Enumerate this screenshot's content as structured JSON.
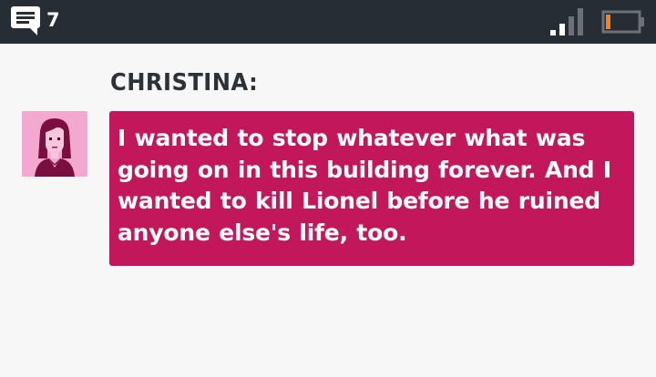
{
  "status_bar": {
    "message_count": "7",
    "icons": {
      "messages": "chat-bubble-icon",
      "signal": "signal-strength-icon",
      "battery": "battery-low-icon"
    },
    "colors": {
      "background": "#262d34",
      "battery_level": "#f5821f"
    },
    "battery_level": 0.15,
    "signal_bars_active": 2,
    "signal_bars_total": 4
  },
  "dialogue": {
    "speaker": "CHRISTINA:",
    "portrait": "christina-portrait",
    "text": "I wanted to stop whatever what was going on in this building forever. And I wanted to kill Lionel before he ruined anyone else's life, too.",
    "colors": {
      "box": "#c2185b",
      "text": "#ffffff",
      "speaker": "#2b3238",
      "portrait_bg": "#f3a9cf"
    }
  }
}
